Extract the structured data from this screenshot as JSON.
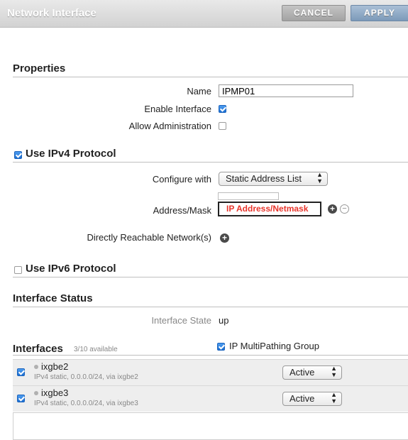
{
  "window": {
    "title": "Network Interface"
  },
  "toolbar": {
    "cancel_label": "CANCEL",
    "apply_label": "APPLY"
  },
  "properties": {
    "heading": "Properties",
    "name_label": "Name",
    "name_value": "IPMP01",
    "enable_label": "Enable Interface",
    "enable_checked": true,
    "admin_label": "Allow Administration",
    "admin_checked": false
  },
  "ipv4": {
    "heading": "Use IPv4 Protocol",
    "checked": true,
    "configure_label": "Configure with",
    "configure_value": "Static Address List",
    "address_label": "Address/Mask",
    "address_placeholder": "IP Address/Netmask",
    "reachable_label": "Directly Reachable Network(s)"
  },
  "ipv6": {
    "heading": "Use IPv6 Protocol",
    "checked": false
  },
  "status": {
    "heading": "Interface Status",
    "state_label": "Interface State",
    "state_value": "up"
  },
  "interfaces": {
    "heading": "Interfaces",
    "available": "3/10 available",
    "ipmp_label": "IP MultiPathing Group",
    "ipmp_checked": true,
    "items": [
      {
        "name": "ixgbe2",
        "desc": "IPv4 static, 0.0.0.0/24, via ixgbe2",
        "status": "Active",
        "checked": true
      },
      {
        "name": "ixgbe3",
        "desc": "IPv4 static, 0.0.0.0/24, via ixgbe3",
        "status": "Active",
        "checked": true
      }
    ]
  },
  "icons": {
    "add": "plus-circle-icon",
    "remove": "minus-circle-icon",
    "select": "up-down-arrows-icon"
  },
  "colors": {
    "placeholder_red": "#e8342a",
    "checkbox_blue": "#1d6fd1"
  }
}
